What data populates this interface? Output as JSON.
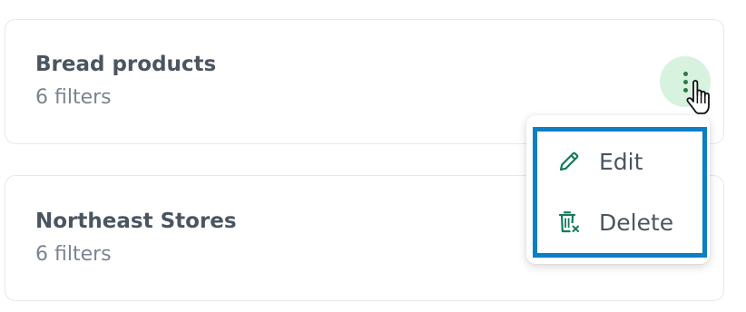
{
  "cards": [
    {
      "title": "Bread products",
      "subtitle": "6 filters"
    },
    {
      "title": "Northeast Stores",
      "subtitle": "6 filters"
    }
  ],
  "context_menu": {
    "items": [
      {
        "label": "Edit",
        "icon": "pencil-icon"
      },
      {
        "label": "Delete",
        "icon": "trash-icon"
      }
    ]
  },
  "colors": {
    "text_primary": "#4a5561",
    "text_secondary": "#7b8490",
    "accent_green": "#2f7a44",
    "kebab_bg": "#d7f2df",
    "icon_teal": "#167a5c",
    "highlight_blue": "#0a7fc4"
  }
}
